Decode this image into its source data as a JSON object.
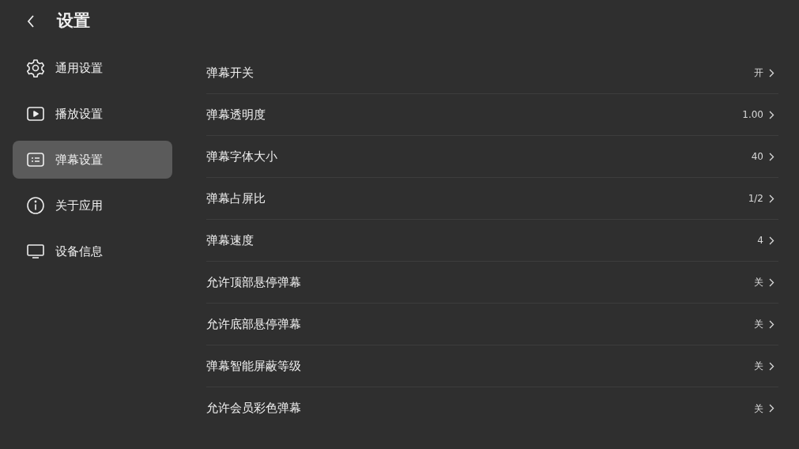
{
  "header": {
    "title": "设置"
  },
  "sidebar": {
    "items": [
      {
        "label": "通用设置",
        "kind": "gear",
        "selected": false
      },
      {
        "label": "播放设置",
        "kind": "play",
        "selected": false
      },
      {
        "label": "弹幕设置",
        "kind": "danmaku",
        "selected": true
      },
      {
        "label": "关于应用",
        "kind": "info",
        "selected": false
      },
      {
        "label": "设备信息",
        "kind": "tv",
        "selected": false
      }
    ]
  },
  "settings": [
    {
      "label": "弹幕开关",
      "value": "开"
    },
    {
      "label": "弹幕透明度",
      "value": "1.00"
    },
    {
      "label": "弹幕字体大小",
      "value": "40"
    },
    {
      "label": "弹幕占屏比",
      "value": "1/2"
    },
    {
      "label": "弹幕速度",
      "value": "4"
    },
    {
      "label": "允许顶部悬停弹幕",
      "value": "关"
    },
    {
      "label": "允许底部悬停弹幕",
      "value": "关"
    },
    {
      "label": "弹幕智能屏蔽等级",
      "value": "关"
    },
    {
      "label": "允许会员彩色弹幕",
      "value": "关"
    }
  ]
}
